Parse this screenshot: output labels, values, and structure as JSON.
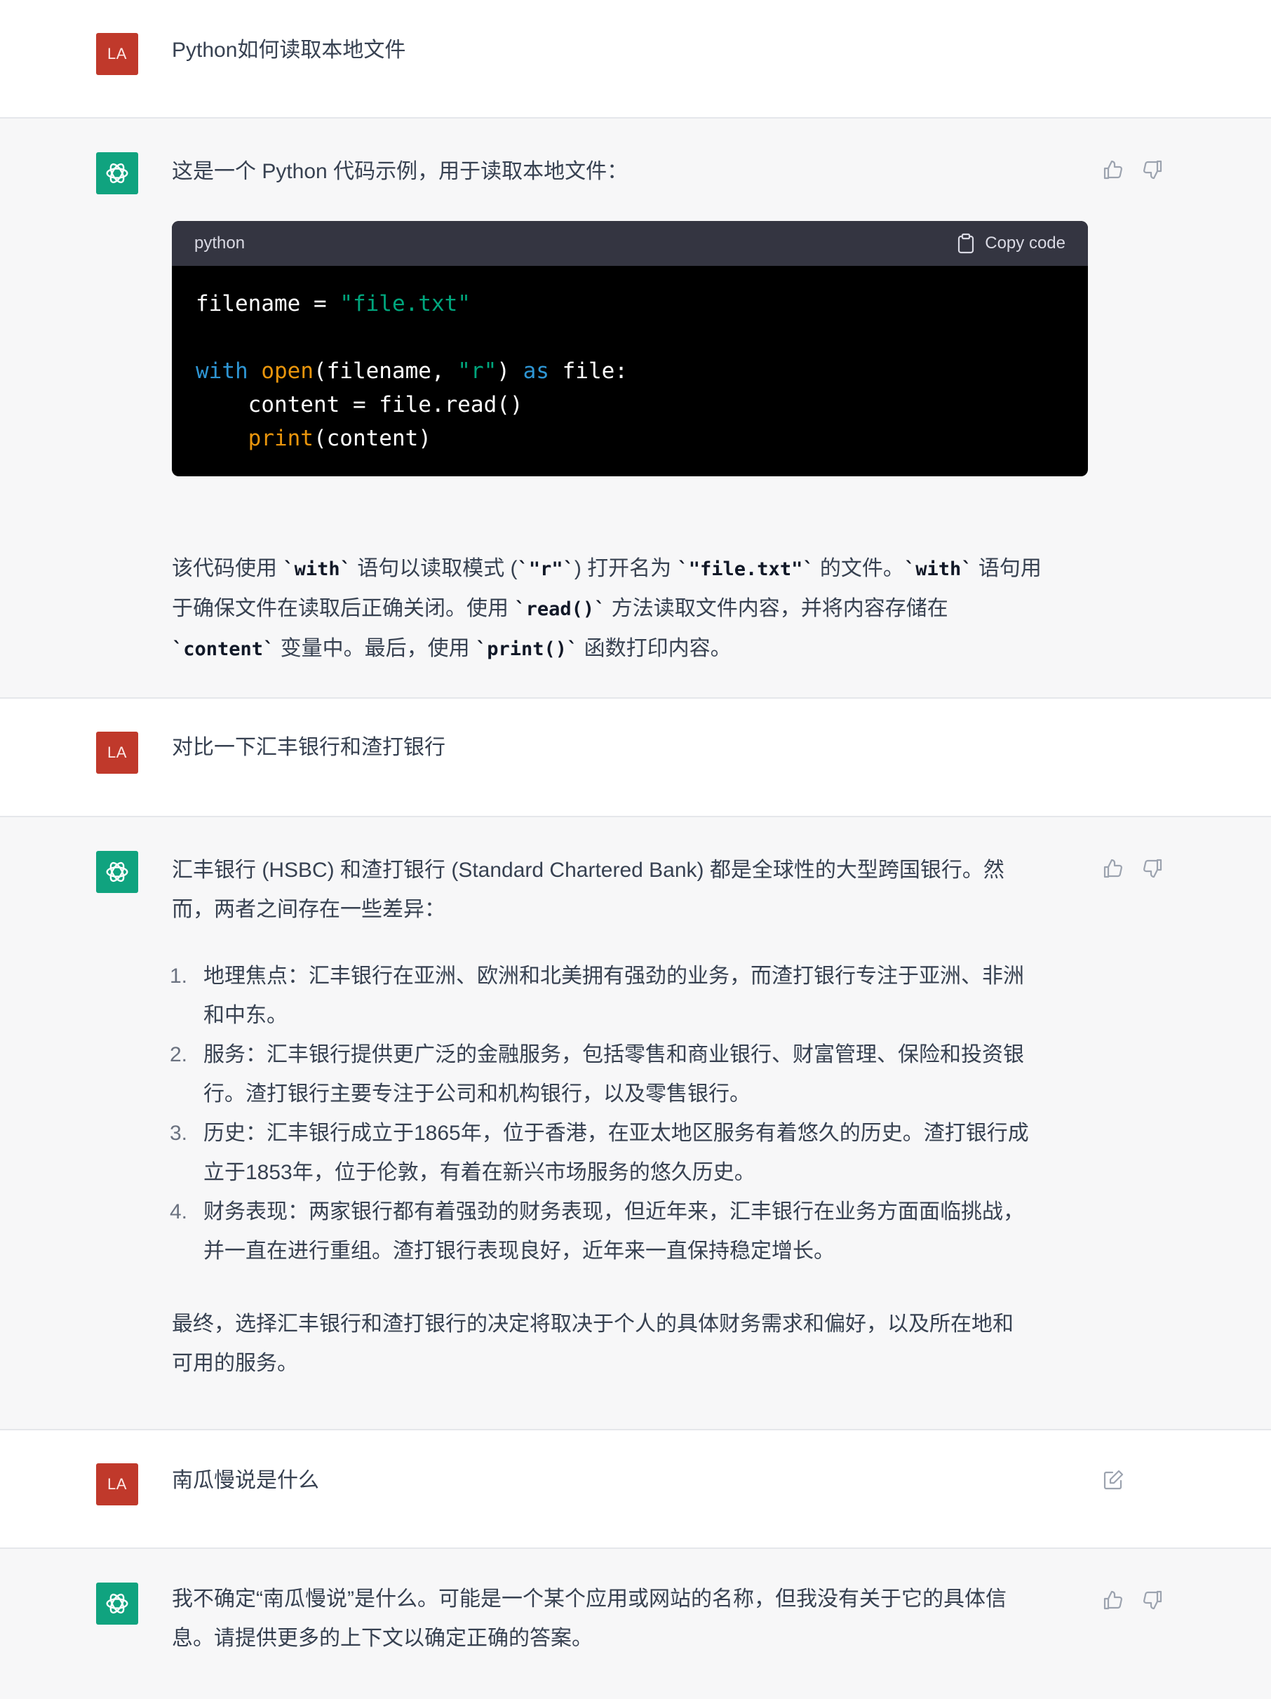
{
  "turns": [
    {
      "role": "user",
      "avatar": "LA",
      "text": "Python如何读取本地文件"
    },
    {
      "role": "assistant",
      "intro": "这是一个 Python 代码示例，用于读取本地文件：",
      "code": {
        "lang": "python",
        "copy_label": "Copy code"
      },
      "explanation": {
        "l1a": "该代码使用 ",
        "l1b": "`with`",
        "l1c": " 语句以读取模式 (",
        "l1d": "`\"r\"`",
        "l1e": ") 打开名为 ",
        "l1f": "`\"file.txt\"`",
        "l1g": " 的文件。",
        "l1h": "`with`",
        "l1i": " 语句用",
        "l2a": "于确保文件在读取后正确关闭。使用 ",
        "l2b": "`read()`",
        "l2c": " 方法读取文件内容，并将内容存储在",
        "l3a": "`content`",
        "l3b": " 变量中。最后，使用 ",
        "l3c": "`print()`",
        "l3d": " 函数打印内容。"
      }
    },
    {
      "role": "user",
      "avatar": "LA",
      "text": "对比一下汇丰银行和渣打银行"
    },
    {
      "role": "assistant",
      "intro_l1": "汇丰银行 (HSBC) 和渣打银行 (Standard Chartered Bank) 都是全球性的大型跨国银行。然",
      "intro_l2": "而，两者之间存在一些差异：",
      "items": [
        {
          "num": "1.",
          "l1": "地理焦点：汇丰银行在亚洲、欧洲和北美拥有强劲的业务，而渣打银行专注于亚洲、非洲",
          "l2": "和中东。"
        },
        {
          "num": "2.",
          "l1": "服务：汇丰银行提供更广泛的金融服务，包括零售和商业银行、财富管理、保险和投资银",
          "l2": "行。渣打银行主要专注于公司和机构银行，以及零售银行。"
        },
        {
          "num": "3.",
          "l1": "历史：汇丰银行成立于1865年，位于香港，在亚太地区服务有着悠久的历史。渣打银行成",
          "l2": "立于1853年，位于伦敦，有着在新兴市场服务的悠久历史。"
        },
        {
          "num": "4.",
          "l1": "财务表现：两家银行都有着强劲的财务表现，但近年来，汇丰银行在业务方面面临挑战，",
          "l2": "并一直在进行重组。渣打银行表现良好，近年来一直保持稳定增长。"
        }
      ],
      "conclusion_l1": "最终，选择汇丰银行和渣打银行的决定将取决于个人的具体财务需求和偏好，以及所在地和",
      "conclusion_l2": "可用的服务。"
    },
    {
      "role": "user",
      "avatar": "LA",
      "text": "南瓜慢说是什么"
    },
    {
      "role": "assistant",
      "l1": "我不确定“南瓜慢说”是什么。可能是一个某个应用或网站的名称，但我没有关于它的具体信",
      "l2": "息。请提供更多的上下文以确定正确的答案。"
    }
  ],
  "colors": {
    "user_avatar": "#c0392b",
    "assistant_avatar": "#10a37f",
    "assistant_bg": "#f7f7f8",
    "code_bg": "#000000",
    "code_header_bg": "#343541"
  },
  "icons": {
    "thumbs_up": "thumbs-up-icon",
    "thumbs_down": "thumbs-down-icon",
    "edit": "edit-icon",
    "copy": "clipboard-icon",
    "assistant_logo": "openai-logo-icon"
  }
}
